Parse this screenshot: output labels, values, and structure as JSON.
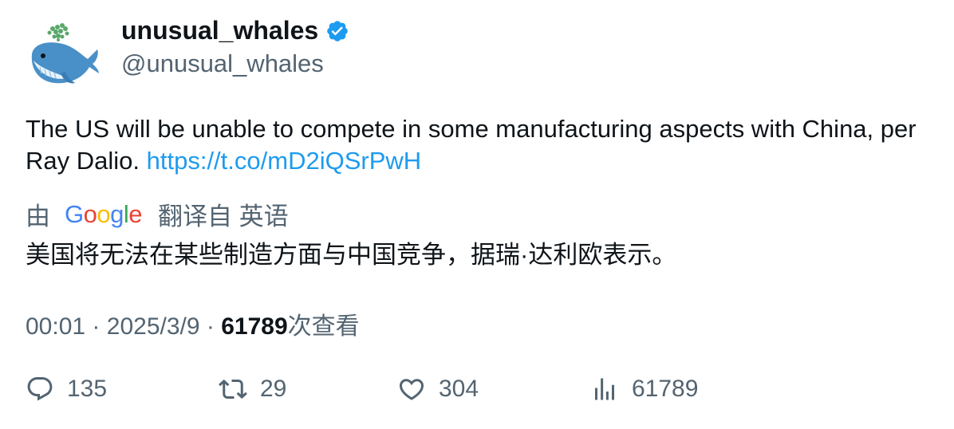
{
  "author": {
    "name": "unusual_whales",
    "handle": "@unusual_whales",
    "verified": true,
    "avatar_icon": "whale-avatar"
  },
  "tweet": {
    "text": "The US will be unable to compete in some manufacturing aspects with China, per Ray Dalio.",
    "link": "https://t.co/mD2iQSrPwH"
  },
  "translation": {
    "prefix": "由",
    "provider": "Google",
    "suffix": "翻译自 英语",
    "text": "美国将无法在某些制造方面与中国竞争，据瑞·达利欧表示。"
  },
  "meta": {
    "time": "00:01",
    "separator": "·",
    "date": "2025/3/9",
    "views_count": "61789",
    "views_label": "次查看"
  },
  "actions": {
    "replies": "135",
    "retweets": "29",
    "likes": "304",
    "views": "61789"
  },
  "colors": {
    "link": "#1d9bf0",
    "secondary_text": "#536471",
    "primary_text": "#0f1419",
    "verified": "#1d9bf0"
  }
}
